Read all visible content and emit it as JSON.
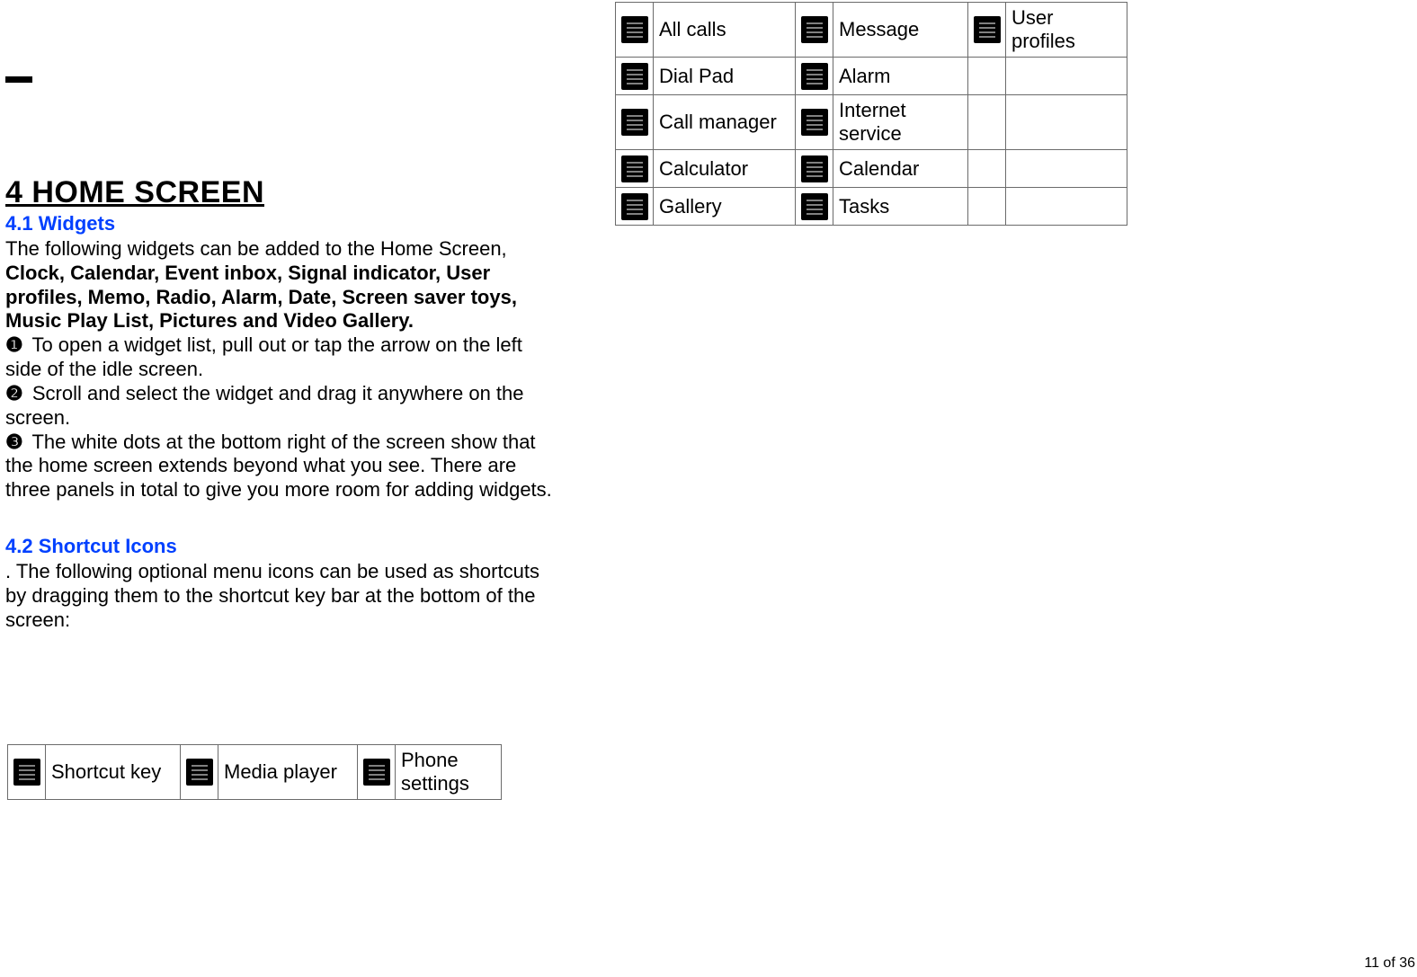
{
  "heading": "4 HOME SCREEN",
  "section1": {
    "title": "4.1 Widgets",
    "intro": "The following widgets can be added to the Home Screen,",
    "boldList": "Clock, Calendar, Event inbox, Signal indicator, User profiles, Memo, Radio, Alarm, Date, Screen saver toys, Music Play List, Pictures and Video Gallery.",
    "steps": {
      "s1n": "❶",
      "s1": " To open a widget list, pull out or tap the arrow on the left side of the idle screen.",
      "s2n": "❷",
      "s2": " Scroll and select the widget and drag it anywhere on the screen.",
      "s3n": "❸",
      "s3": " The white dots at the bottom right of the screen show that the home screen extends beyond what you see. There are three panels in total to give you more room for adding widgets."
    }
  },
  "section2": {
    "title": "4.2 Shortcut Icons",
    "intro": ". The following optional menu icons can be used as shortcuts by dragging them to the shortcut key bar at the bottom of the screen:"
  },
  "tableLeft": {
    "r0c0": "Shortcut key",
    "r0c1": "Media player",
    "r0c2": "Phone settings"
  },
  "tableRight": {
    "r0c0": "All calls",
    "r0c1": "Message",
    "r0c2": "User profiles",
    "r1c0": "Dial Pad",
    "r1c1": "Alarm",
    "r1c2": "",
    "r2c0": "Call manager",
    "r2c1": "Internet service",
    "r2c2": "",
    "r3c0": "Calculator",
    "r3c1": "Calendar",
    "r3c2": "",
    "r4c0": "Gallery",
    "r4c1": "Tasks",
    "r4c2": ""
  },
  "footer": "11  of  36"
}
